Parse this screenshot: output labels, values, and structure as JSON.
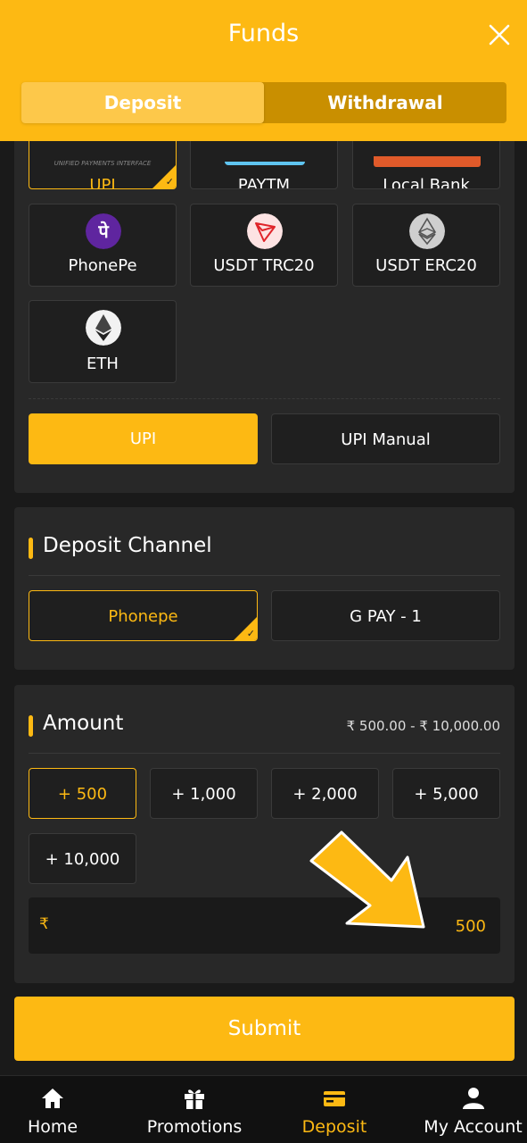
{
  "header": {
    "title": "Funds"
  },
  "tabs": [
    {
      "label": "Deposit",
      "active": true
    },
    {
      "label": "Withdrawal",
      "active": false
    }
  ],
  "methods": [
    {
      "label": "UPI",
      "logo_text": "UNIFIED PAYMENTS INTERFACE",
      "selected": true
    },
    {
      "label": "PAYTM",
      "selected": false
    },
    {
      "label": "Local Bank",
      "selected": false
    },
    {
      "label": "PhonePe",
      "icon": "phonepe-icon",
      "selected": false
    },
    {
      "label": "USDT TRC20",
      "icon": "tron-icon",
      "selected": false
    },
    {
      "label": "USDT ERC20",
      "icon": "ethereum-icon",
      "selected": false
    },
    {
      "label": "ETH",
      "icon": "ethereum-icon",
      "selected": false
    }
  ],
  "subtypes": [
    {
      "label": "UPI",
      "selected": true
    },
    {
      "label": "UPI Manual",
      "selected": false
    }
  ],
  "channel": {
    "title": "Deposit Channel",
    "options": [
      {
        "label": "Phonepe",
        "selected": true
      },
      {
        "label": "G PAY - 1",
        "selected": false
      }
    ]
  },
  "amount": {
    "title": "Amount",
    "range": "₹ 500.00 - ₹ 10,000.00",
    "presets": [
      "+ 500",
      "+ 1,000",
      "+ 2,000",
      "+ 5,000",
      "+ 10,000"
    ],
    "selected_preset": "+ 500",
    "currency": "₹",
    "value": "500"
  },
  "submit_label": "Submit",
  "nav": [
    {
      "label": "Home",
      "icon": "home-icon"
    },
    {
      "label": "Promotions",
      "icon": "gift-icon"
    },
    {
      "label": "Deposit",
      "icon": "wallet-card-icon",
      "active": true
    },
    {
      "label": "My Account",
      "icon": "user-icon"
    }
  ],
  "colors": {
    "accent": "#fdb913",
    "background": "#1a1a1a",
    "card": "#282828"
  }
}
